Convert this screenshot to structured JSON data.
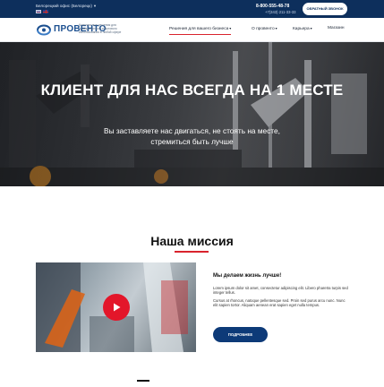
{
  "topbar": {
    "office_label": "Белорецкий офис (Белорецк)",
    "caret": "▾",
    "phone_main": "8-800-555-48-78",
    "phone_secondary": "+7(343) 211-33-33",
    "callback_label": "ОБРАТНЫЙ ЗВОНОК"
  },
  "header": {
    "logo_text": "ПРОВЕНТО",
    "logo_desc": "Комплексные решения для промышленного и бытового использования в любой сфере",
    "nav": [
      {
        "label": "Решения для вашего бизнеса",
        "caret": "▾"
      },
      {
        "label": "О провенто",
        "caret": "▾"
      },
      {
        "label": "Карьера",
        "caret": "▾"
      },
      {
        "label": "Магазин",
        "caret": ""
      }
    ]
  },
  "hero": {
    "title": "КЛИЕНТ ДЛЯ НАС ВСЕГДА НА 1 МЕСТЕ",
    "subtitle_line1": "Вы заставляете нас двигаться, не стоять на месте,",
    "subtitle_line2": "стремиться быть лучше"
  },
  "mission": {
    "title": "Наша миссия",
    "heading": "Мы делаем жизнь лучше!",
    "paragraph1": "Lorem ipsum dolor sit amet, consectetur adipiscing elit. Libero pharetra turpis sed integer tellus.",
    "paragraph2": "Cursus at rhoncus, natoque pellentesque sed. Proin sed purus arcu nunc. Nunc elit sapien tortor. Aliquam aenean erat sapien eget nulla tempus.",
    "more_label": "ПОДРОБНЕЕ"
  },
  "colors": {
    "navy": "#0d2f5c",
    "accent_red": "#d9232d",
    "button_blue": "#0d3a78"
  }
}
